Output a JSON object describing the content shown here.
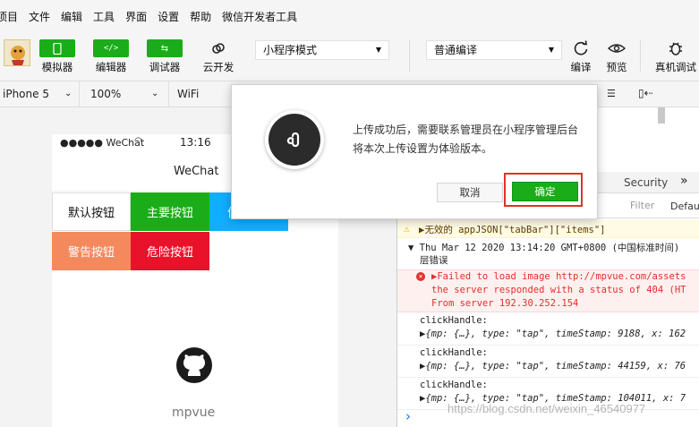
{
  "menu": [
    "项目",
    "文件",
    "编辑",
    "工具",
    "界面",
    "设置",
    "帮助",
    "微信开发者工具"
  ],
  "toolbar": {
    "simulator": "模拟器",
    "editor": "编辑器",
    "debugger": "调试器",
    "cloud": "云开发",
    "mode": "小程序模式",
    "compile_mode": "普通编译",
    "compile": "编译",
    "preview": "预览",
    "real_debug": "真机调试"
  },
  "device_bar": {
    "device": "iPhone 5",
    "zoom": "100%",
    "network": "WiFi"
  },
  "phone": {
    "carrier": "●●●●● WeChat",
    "time": "13:16",
    "nav_title": "WeChat",
    "btn_default": "默认按钮",
    "btn_primary": "主要按钮",
    "btn_third": "信",
    "btn_warn": "警告按钮",
    "btn_danger": "危险按钮",
    "brand": "mpvue"
  },
  "devtools": {
    "tab_security": "Security",
    "more": "»",
    "filter_placeholder": "Filter",
    "level": "Defau",
    "warn_text": "▶无效的 appJSON[\"tabBar\"][\"items\"]",
    "group_line1": "▼ Thu Mar 12 2020 13:14:20 GMT+0800 (中国标准时间)",
    "group_line2": "层错误",
    "error_line1": "▶Failed to load image http://mpvue.com/assets",
    "error_line2": "the server responded with a status of 404 (HT",
    "error_line3": "From server 192.30.252.154",
    "logs": [
      {
        "label": "clickHandle:",
        "detail": "▶{mp: {…}, type: \"tap\", timeStamp: 9188, x: 162"
      },
      {
        "label": "clickHandle:",
        "detail": "▶{mp: {…}, type: \"tap\", timeStamp: 44159, x: 76"
      },
      {
        "label": "clickHandle:",
        "detail": "▶{mp: {…}, type: \"tap\", timeStamp: 104011, x: 7"
      }
    ],
    "prompt": "›"
  },
  "modal": {
    "message": "上传成功后，需要联系管理员在小程序管理后台将本次上传设置为体验版本。",
    "cancel": "取消",
    "confirm": "确定"
  },
  "watermark": "https://blog.csdn.net/weixin_46540977",
  "colors": {
    "green": "#1aad19",
    "blue": "#10aeff",
    "red": "#e64340",
    "orange": "#f5895e"
  }
}
